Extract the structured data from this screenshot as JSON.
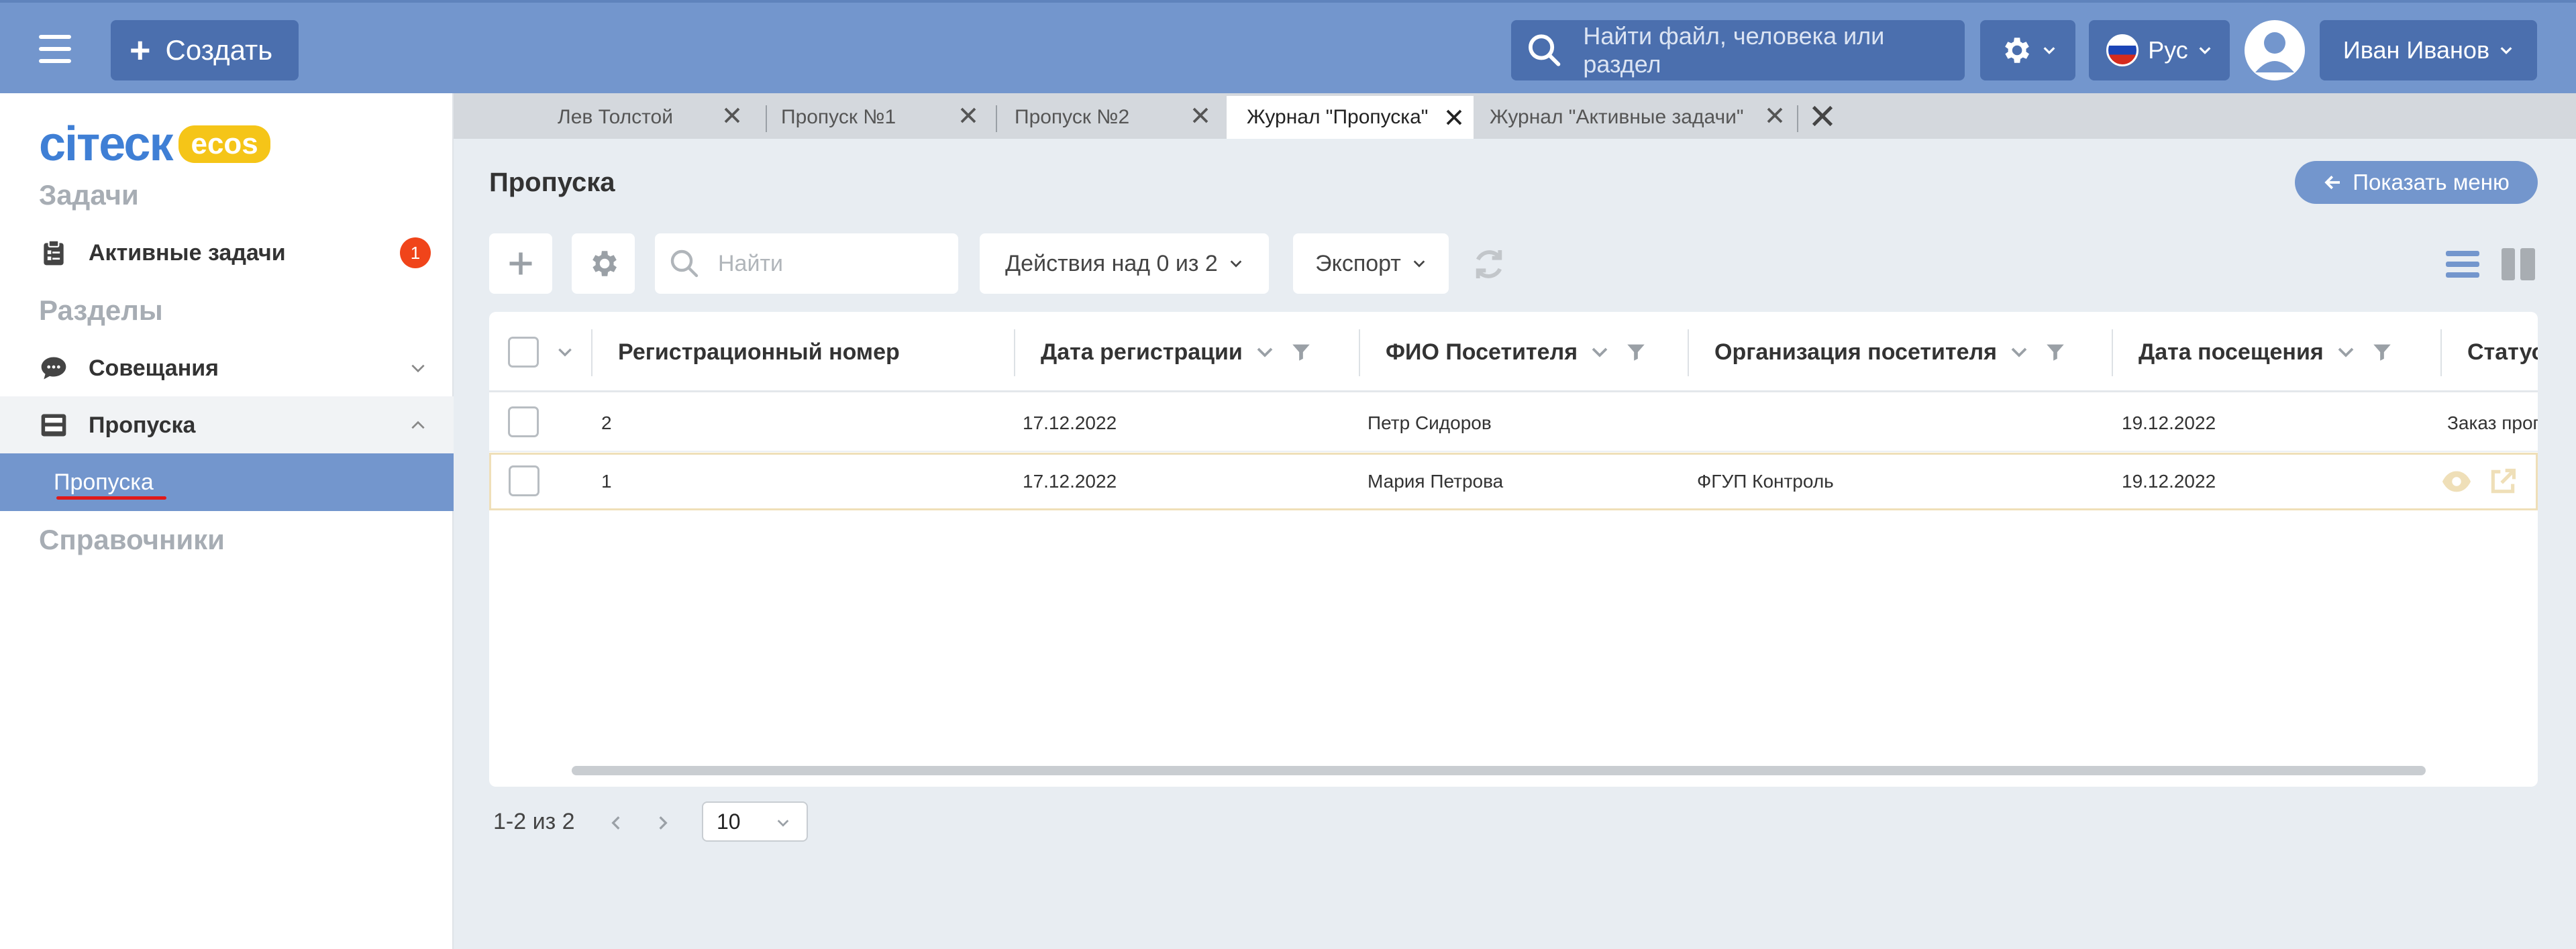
{
  "topbar": {
    "create_label": "Создать",
    "search_placeholder": "Найти файл, человека или раздел",
    "language": "Рус",
    "user_name": "Иван Иванов"
  },
  "sidebar": {
    "logo_text": "ciтеск",
    "logo_badge": "ecos",
    "section_tasks": "Задачи",
    "active_tasks_label": "Активные задачи",
    "active_tasks_count": "1",
    "section_sections": "Разделы",
    "meetings_label": "Совещания",
    "passes_label": "Пропуска",
    "passes_sub_label": "Пропуска",
    "section_refs": "Справочники"
  },
  "tabs": [
    {
      "label": "Лев Толстой",
      "active": false
    },
    {
      "label": "Пропуск №1",
      "active": false
    },
    {
      "label": "Пропуск №2",
      "active": false
    },
    {
      "label": "Журнал \"Пропуска\"",
      "active": true
    },
    {
      "label": "Журнал \"Активные задачи\"",
      "active": false
    }
  ],
  "main": {
    "title": "Пропуска",
    "show_menu_label": "Показать меню",
    "search_placeholder": "Найти",
    "actions_label": "Действия над 0 из 2",
    "export_label": "Экспорт"
  },
  "table": {
    "columns": [
      "Регистрационный номер",
      "Дата регистрации",
      "ФИО Посетителя",
      "Организация посетителя",
      "Дата посещения",
      "Статус"
    ],
    "rows": [
      {
        "reg_number": "2",
        "reg_date": "17.12.2022",
        "visitor": "Петр Сидоров",
        "org": "",
        "visit_date": "19.12.2022",
        "status": "Заказ пропу"
      },
      {
        "reg_number": "1",
        "reg_date": "17.12.2022",
        "visitor": "Мария Петрова",
        "org": "ФГУП Контроль",
        "visit_date": "19.12.2022",
        "status": ""
      }
    ]
  },
  "pagination": {
    "range_text": "1-2 из 2",
    "page_size": "10"
  },
  "colors": {
    "topbar": "#7396cd",
    "topbar_button": "#4b6fae",
    "badge": "#f0441a",
    "highlight_border": "#efdfb8"
  }
}
